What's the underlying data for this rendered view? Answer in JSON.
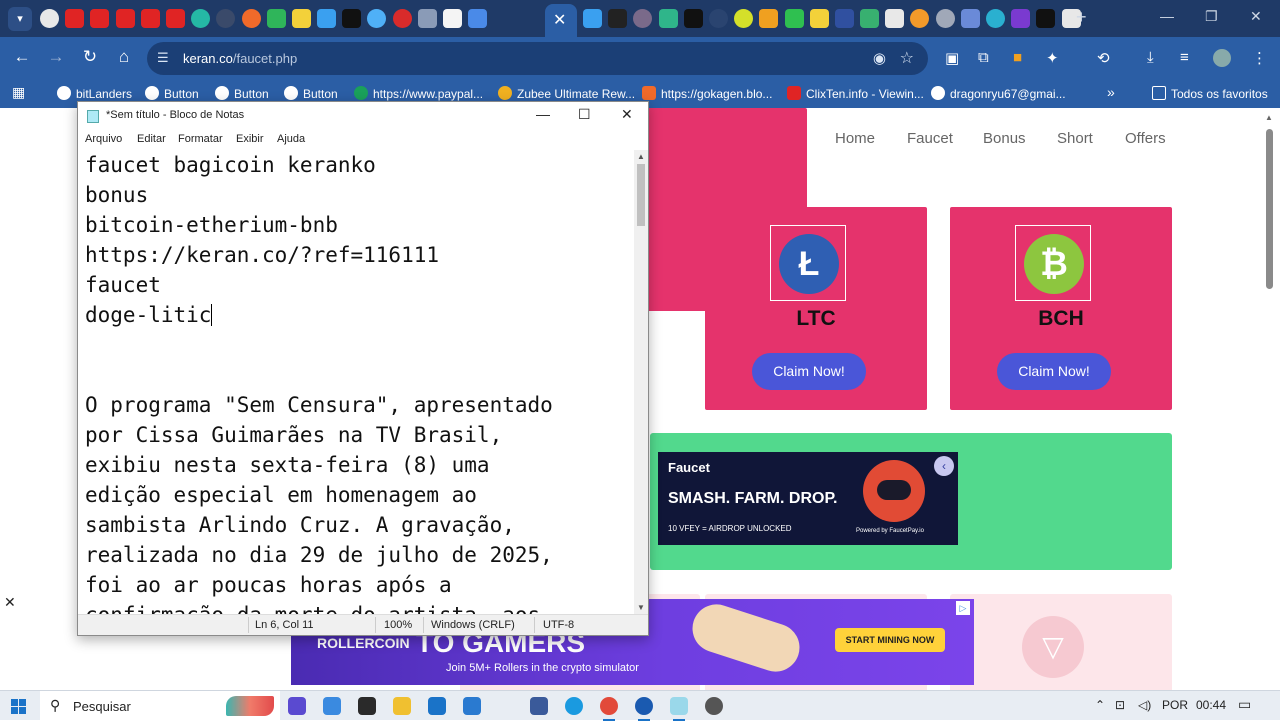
{
  "browser": {
    "url_host": "keran.co",
    "url_path": "/faucet.php",
    "bookmarks": [
      {
        "label": "bitLanders"
      },
      {
        "label": "Button"
      },
      {
        "label": "Button"
      },
      {
        "label": "Button"
      },
      {
        "label": "https://www.paypal..."
      },
      {
        "label": "Zubee Ultimate Rew..."
      },
      {
        "label": "https://gokagen.blo..."
      },
      {
        "label": "ClixTen.info - Viewin..."
      },
      {
        "label": "dragonryu67@gmai..."
      },
      {
        "label": "Todos os favoritos"
      }
    ]
  },
  "site": {
    "nav": [
      "Home",
      "Faucet",
      "Bonus",
      "Short",
      "Offers"
    ],
    "cards": [
      {
        "coin": "LTC",
        "symbol": "Ł",
        "color": "#2f5fb3",
        "button": "Claim Now!"
      },
      {
        "coin": "BCH",
        "symbol": "₿",
        "color": "#8dc63f",
        "button": "Claim Now!"
      }
    ],
    "ad_faucet": {
      "logo": "Faucet",
      "headline": "SMASH. FARM. DROP.",
      "sub": "10 VFEY = AIRDROP UNLOCKED",
      "powered": "Powered by FaucetPay.io"
    },
    "ad_roller": {
      "brand": "ROLLERCOIN",
      "headline": "TO GAMERS",
      "sub": "Join 5M+ Rollers in the crypto simulator",
      "button": "START MINING NOW"
    }
  },
  "notepad": {
    "title": "*Sem título - Bloco de Notas",
    "menu": [
      "Arquivo",
      "Editar",
      "Formatar",
      "Exibir",
      "Ajuda"
    ],
    "lines": [
      "faucet bagicoin keranko",
      "bonus",
      "bitcoin-etherium-bnb",
      "https://keran.co/?ref=116111",
      "faucet",
      "doge-litic",
      "",
      "",
      "O programa \"Sem Censura\", apresentado",
      "por Cissa Guimarães na TV Brasil,",
      "exibiu nesta sexta-feira (8) uma",
      "edição especial em homenagem ao",
      "sambista Arlindo Cruz. A gravação,",
      "realizada no dia 29 de julho de 2025,",
      "foi ao ar poucas horas após a",
      "confirmação da morte do artista, aos"
    ],
    "status": {
      "position": "Ln 6, Col 11",
      "zoom": "100%",
      "line_ending": "Windows (CRLF)",
      "encoding": "UTF-8"
    }
  },
  "taskbar": {
    "search_placeholder": "Pesquisar",
    "language": "POR",
    "time": "00:44"
  }
}
